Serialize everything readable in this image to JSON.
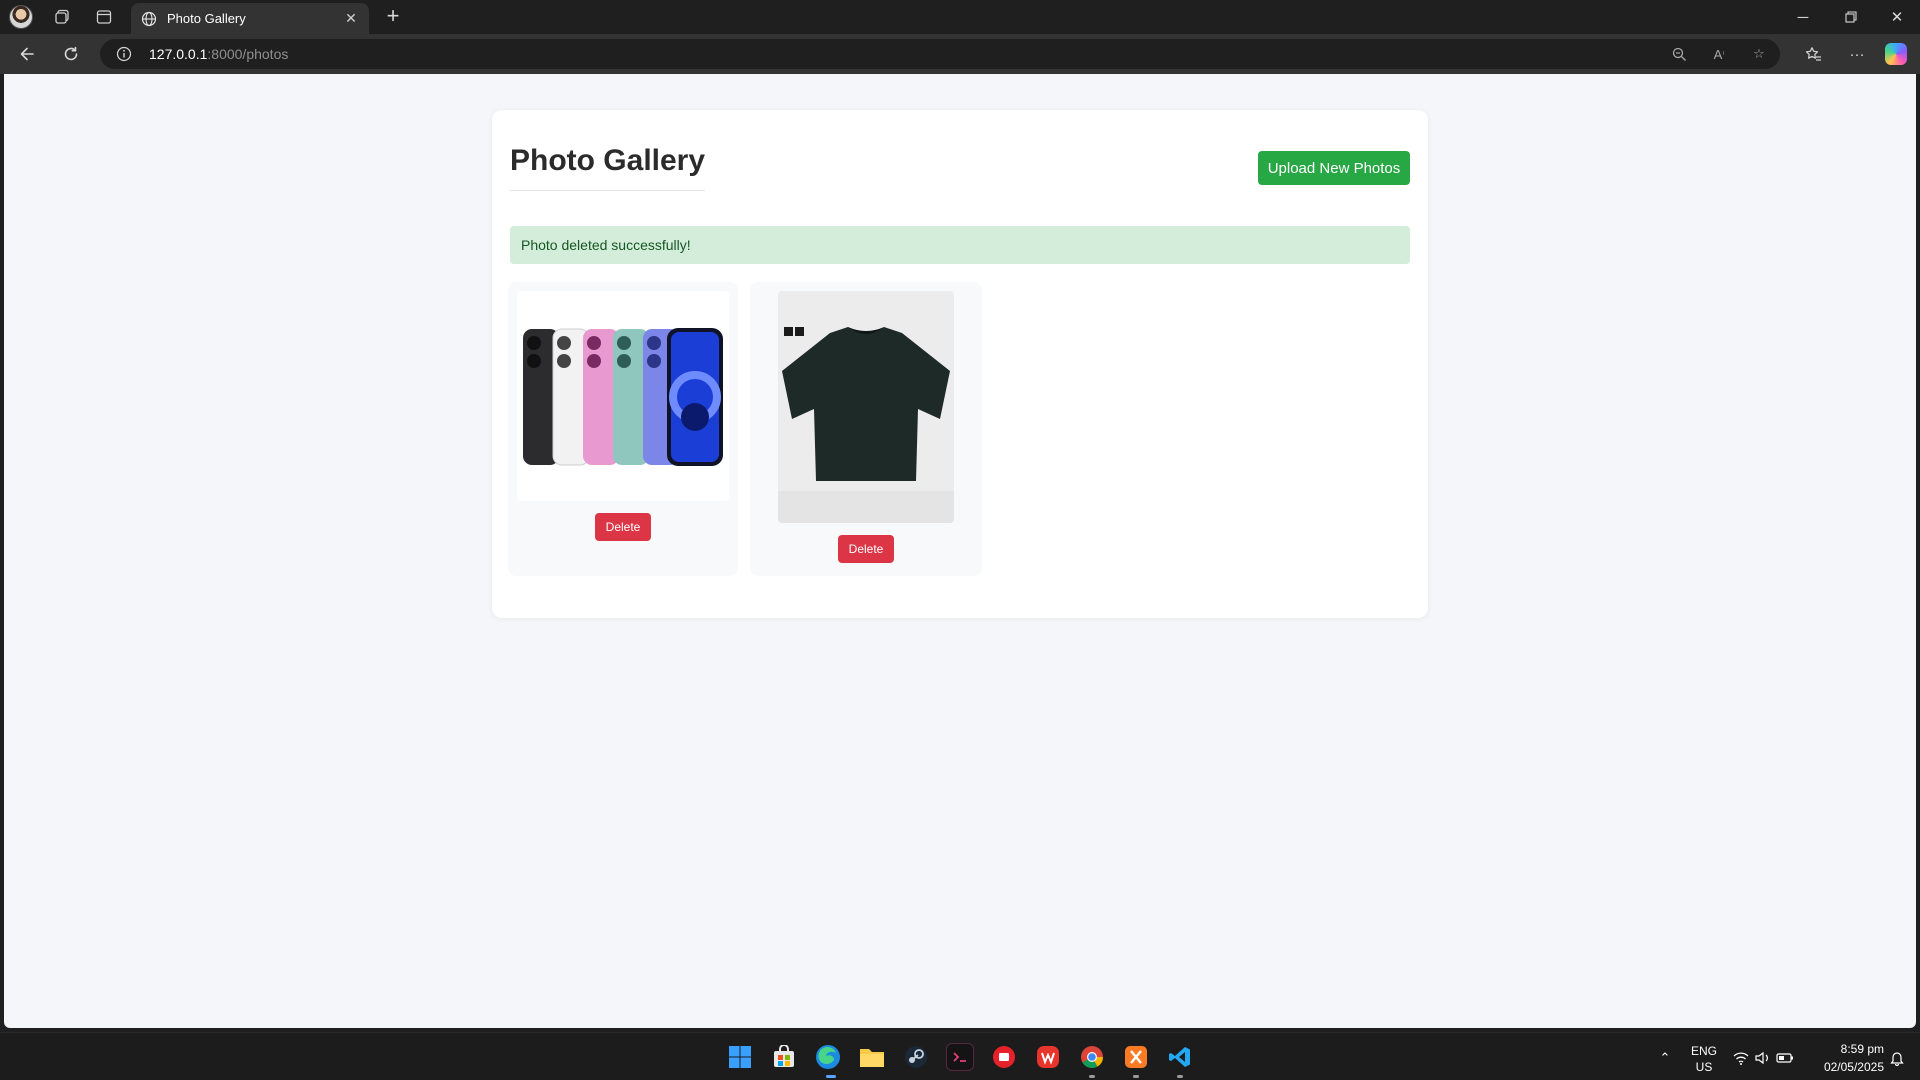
{
  "browser": {
    "tab_title": "Photo Gallery",
    "url_host": "127.0.0.1",
    "url_rest": ":8000/photos"
  },
  "page": {
    "title": "Photo Gallery",
    "upload_label": "Upload New Photos",
    "alert_message": "Photo deleted successfully!",
    "photos": [
      {
        "alt": "iPhone lineup",
        "delete_label": "Delete"
      },
      {
        "alt": "Dark t-shirt",
        "delete_label": "Delete"
      }
    ]
  },
  "colors": {
    "accent_green": "#28a745",
    "danger_red": "#dc3545",
    "alert_bg": "#d4edda",
    "alert_text": "#155724"
  },
  "taskbar": {
    "language": "ENG",
    "region": "US",
    "time": "8:59 pm",
    "date": "02/05/2025",
    "apps": [
      "start-icon",
      "store-icon",
      "edge-icon",
      "file-explorer-icon",
      "steam-icon",
      "terminal-app-icon",
      "app-red-icon",
      "wps-office-icon",
      "chrome-icon",
      "xampp-icon",
      "vscode-icon"
    ]
  }
}
